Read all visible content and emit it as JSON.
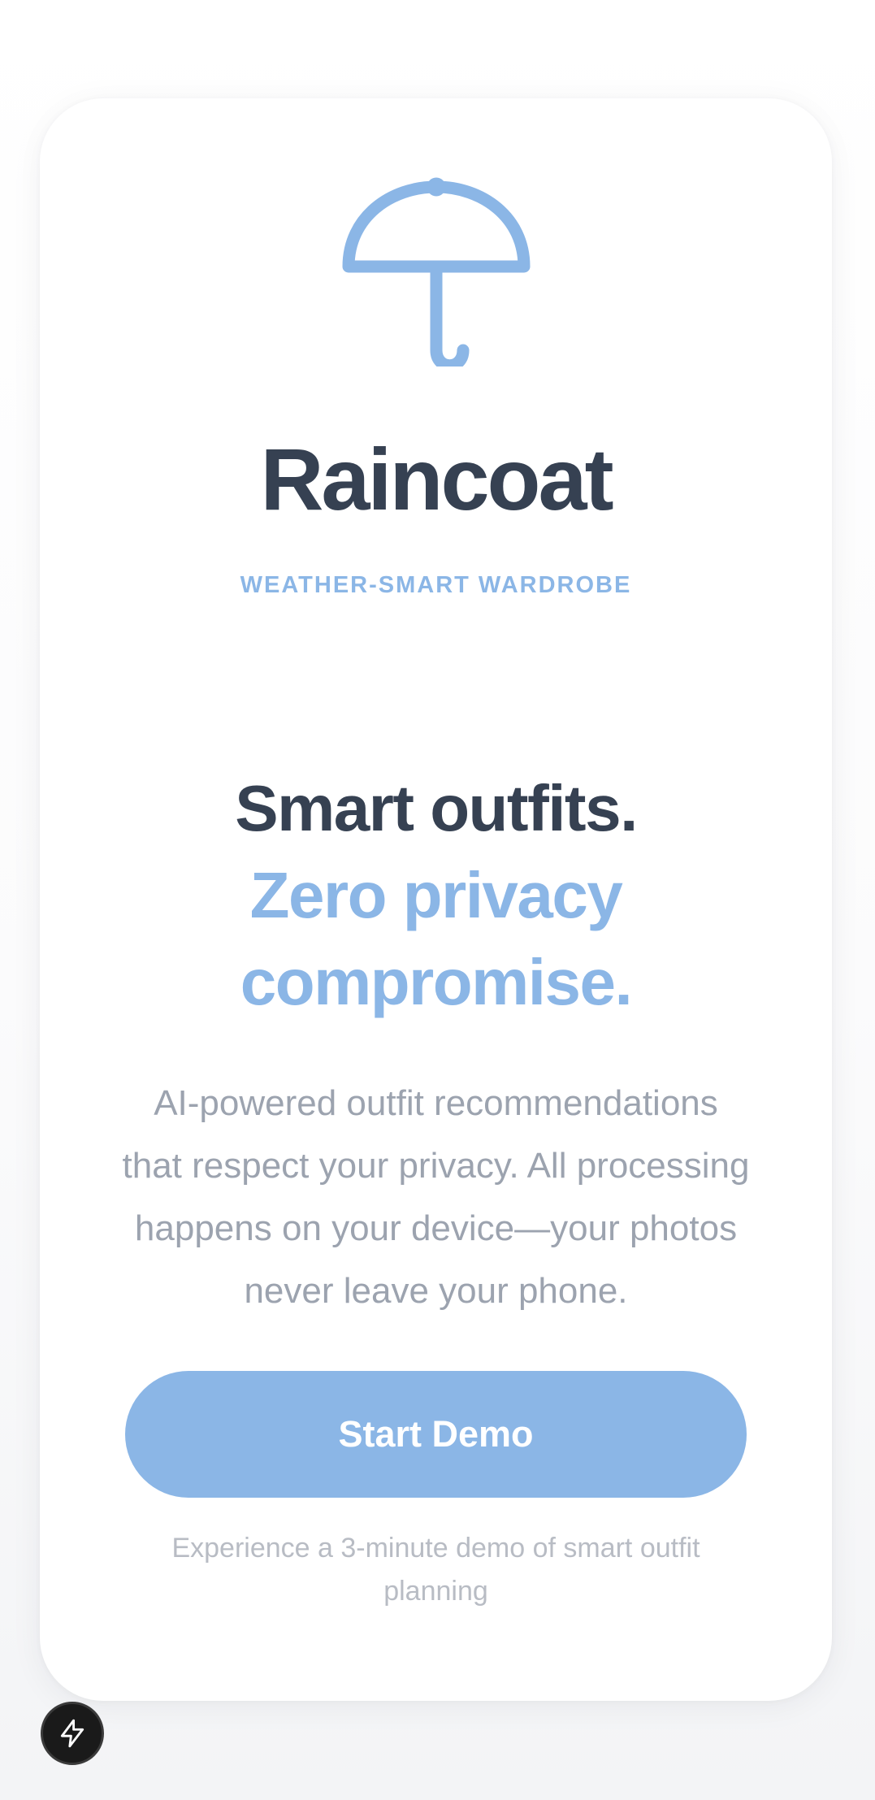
{
  "app": {
    "title": "Raincoat",
    "tagline": "WEATHER-SMART WARDROBE",
    "logo_icon": "umbrella-icon"
  },
  "hero": {
    "headline_line1": "Smart outfits.",
    "headline_line2": "Zero privacy compromise.",
    "description": "AI-powered outfit recommendations that respect your privacy. All processing happens on your device—your photos never leave your phone."
  },
  "cta": {
    "button_label": "Start Demo",
    "note": "Experience a 3-minute demo of smart outfit planning"
  },
  "floating_action": {
    "icon": "lightning-bolt-icon"
  },
  "colors": {
    "accent": "#8bb6e6",
    "heading": "#364152",
    "body_text": "#9ca3af",
    "muted_text": "#b8bcc4",
    "card_background": "#ffffff",
    "fab_background": "#1a1a1a"
  }
}
